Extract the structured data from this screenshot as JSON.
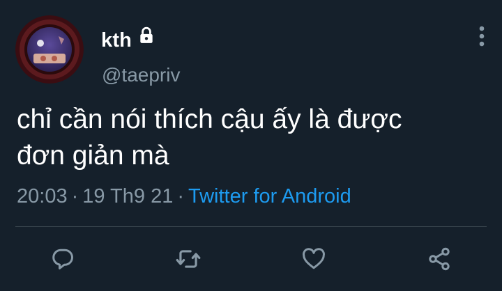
{
  "user": {
    "display_name": "kth",
    "handle": "@taepriv",
    "protected_icon": "lock-icon",
    "avatar_icon": "avatar-image"
  },
  "tweet": {
    "text": "chỉ cần nói thích cậu ấy là được\nđơn giản mà",
    "time": "20:03",
    "date": "19 Th9 21",
    "separator": "·",
    "source": "Twitter for Android"
  },
  "actions": {
    "reply_icon": "reply-icon",
    "retweet_icon": "retweet-icon",
    "like_icon": "heart-icon",
    "share_icon": "share-icon",
    "more_icon": "more-vertical-icon"
  },
  "colors": {
    "background": "#15202b",
    "text_primary": "#ffffff",
    "text_secondary": "#8899a6",
    "link": "#1d9bf0",
    "divider": "#38444d",
    "icon": "#8899a6"
  }
}
